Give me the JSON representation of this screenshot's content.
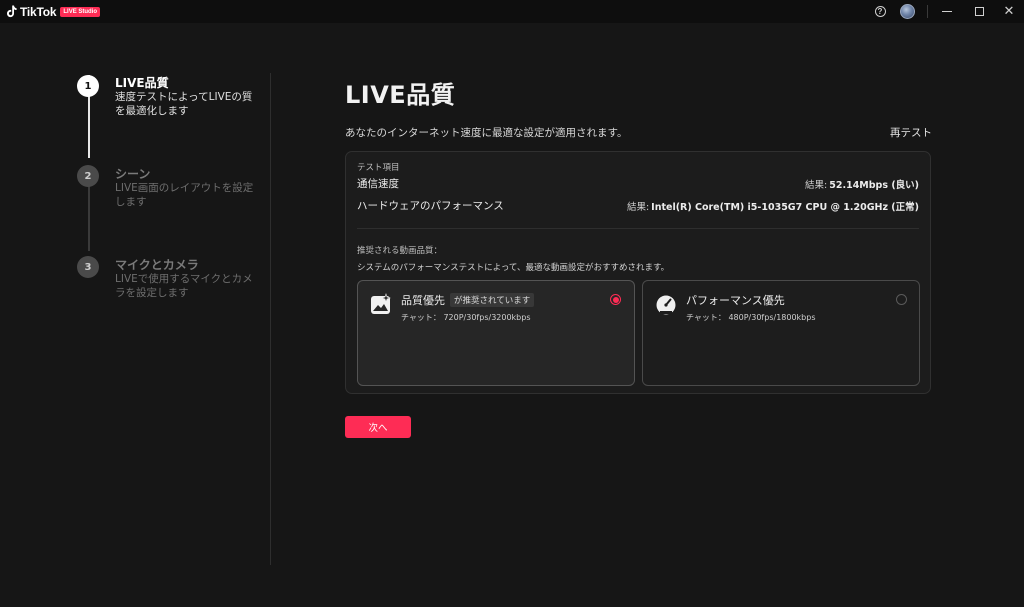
{
  "titlebar": {
    "app_name": "TikTok",
    "badge": "LIVE Studio",
    "help": "?",
    "close": "✕"
  },
  "steps": [
    {
      "num": "1",
      "title": "LIVE品質",
      "desc": "速度テストによってLIVEの質を最適化します",
      "active": true
    },
    {
      "num": "2",
      "title": "シーン",
      "desc": "LIVE画面のレイアウトを設定します",
      "active": false
    },
    {
      "num": "3",
      "title": "マイクとカメラ",
      "desc": "LIVEで使用するマイクとカメラを設定します",
      "active": false
    }
  ],
  "main": {
    "title": "LIVE品質",
    "subtitle": "あなたのインターネット速度に最適な設定が適用されます。",
    "retest": "再テスト",
    "test_items_label": "テスト項目",
    "tests": [
      {
        "label": "通信速度",
        "result_key": "結果:",
        "result_value": "52.14Mbps (良い)"
      },
      {
        "label": "ハードウェアのパフォーマンス",
        "result_key": "結果:",
        "result_value": "Intel(R) Core(TM) i5-1035G7 CPU @ 1.20GHz (正常)"
      }
    ],
    "recommended_label": "推奨される動画品質：",
    "recommended_desc": "システムのパフォーマンステストによって、最適な動画設定がおすすめされます。",
    "options": [
      {
        "title": "品質優先",
        "badge": "が推奨されています",
        "detail": "チャット： 720P/30fps/3200kbps",
        "selected": true,
        "icon": "image-sparkle-icon"
      },
      {
        "title": "パフォーマンス優先",
        "badge": "",
        "detail": "チャット： 480P/30fps/1800kbps",
        "selected": false,
        "icon": "speedometer-icon"
      }
    ],
    "next_label": "次へ"
  },
  "colors": {
    "accent": "#fe2c55",
    "background": "#161616",
    "panel": "#1c1c1c"
  }
}
